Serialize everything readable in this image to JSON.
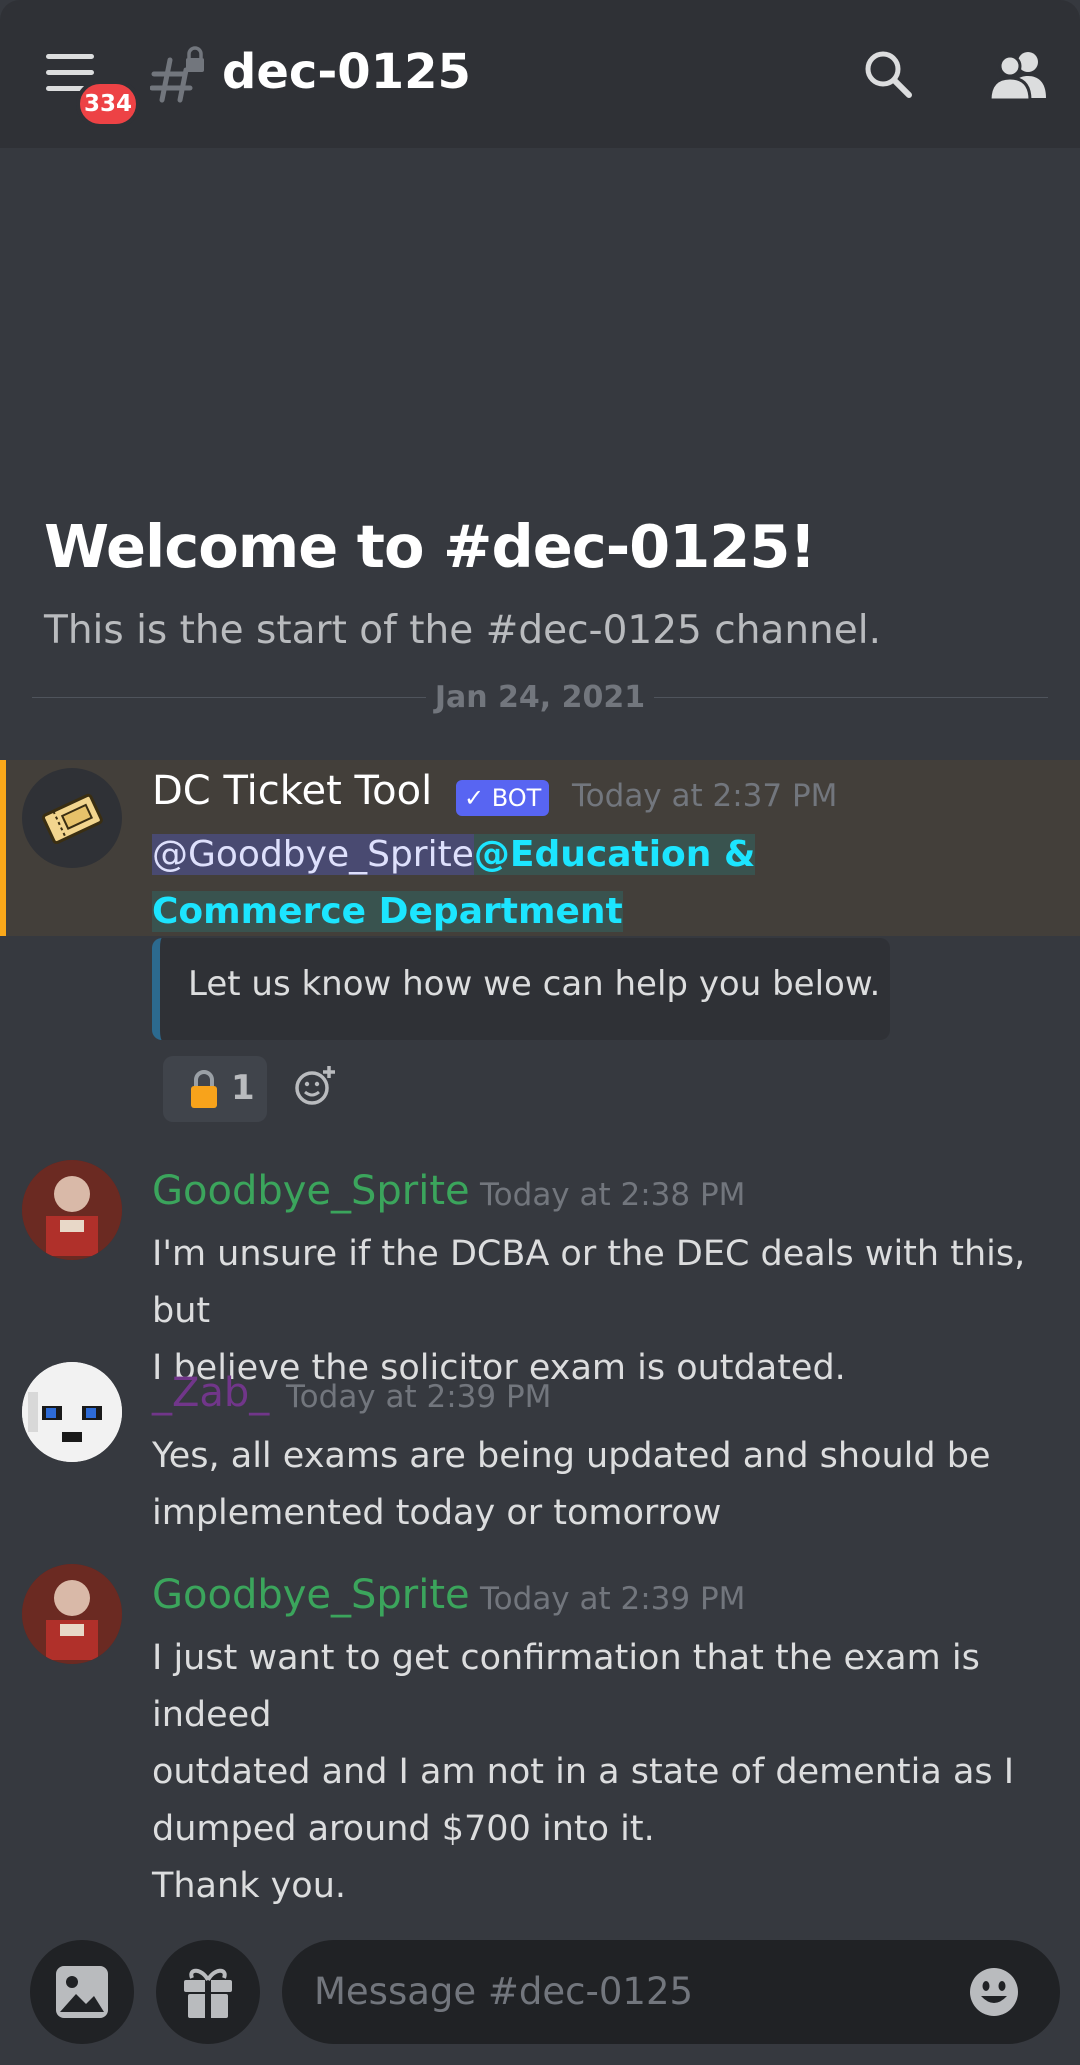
{
  "header": {
    "unread_badge": "334",
    "channel_name": "dec-0125"
  },
  "welcome": {
    "title": "Welcome to #dec-0125!",
    "subtitle": "This is the start of the #dec-0125 channel."
  },
  "date_divider": "Jan 24, 2021",
  "messages": [
    {
      "author": "DC Ticket Tool",
      "bot_tag": "✓ BOT",
      "timestamp": "Today at 2:37 PM",
      "mention_user": "@Goodbye_Sprite",
      "mention_role": "@Education & Commerce Department",
      "embed_text": "Let us know how we can help you below.",
      "reaction_count": "1"
    },
    {
      "author": "Goodbye_Sprite",
      "timestamp": "Today at 2:38 PM",
      "lines": [
        "I'm unsure if the DCBA or the DEC deals with this, but",
        "I believe the solicitor exam is outdated."
      ]
    },
    {
      "author": "_Zab_",
      "timestamp": "Today at 2:39 PM",
      "lines": [
        "Yes, all exams are being updated and should be",
        "implemented today or tomorrow"
      ]
    },
    {
      "author": "Goodbye_Sprite",
      "timestamp": "Today at 2:39 PM",
      "lines": [
        "I just want to get confirmation that the exam is indeed",
        "outdated and I am not in a state of dementia as I",
        "dumped around $700 into it.",
        "Thank you."
      ]
    }
  ],
  "composer": {
    "placeholder": "Message #dec-0125"
  },
  "colors": {
    "background": "#36393f",
    "header": "#2f3136",
    "goodbye_sprite_name": "#3ba55c",
    "zab_name": "#71368a",
    "badge": "#ed4245",
    "mention_highlight": "#faa81a"
  }
}
